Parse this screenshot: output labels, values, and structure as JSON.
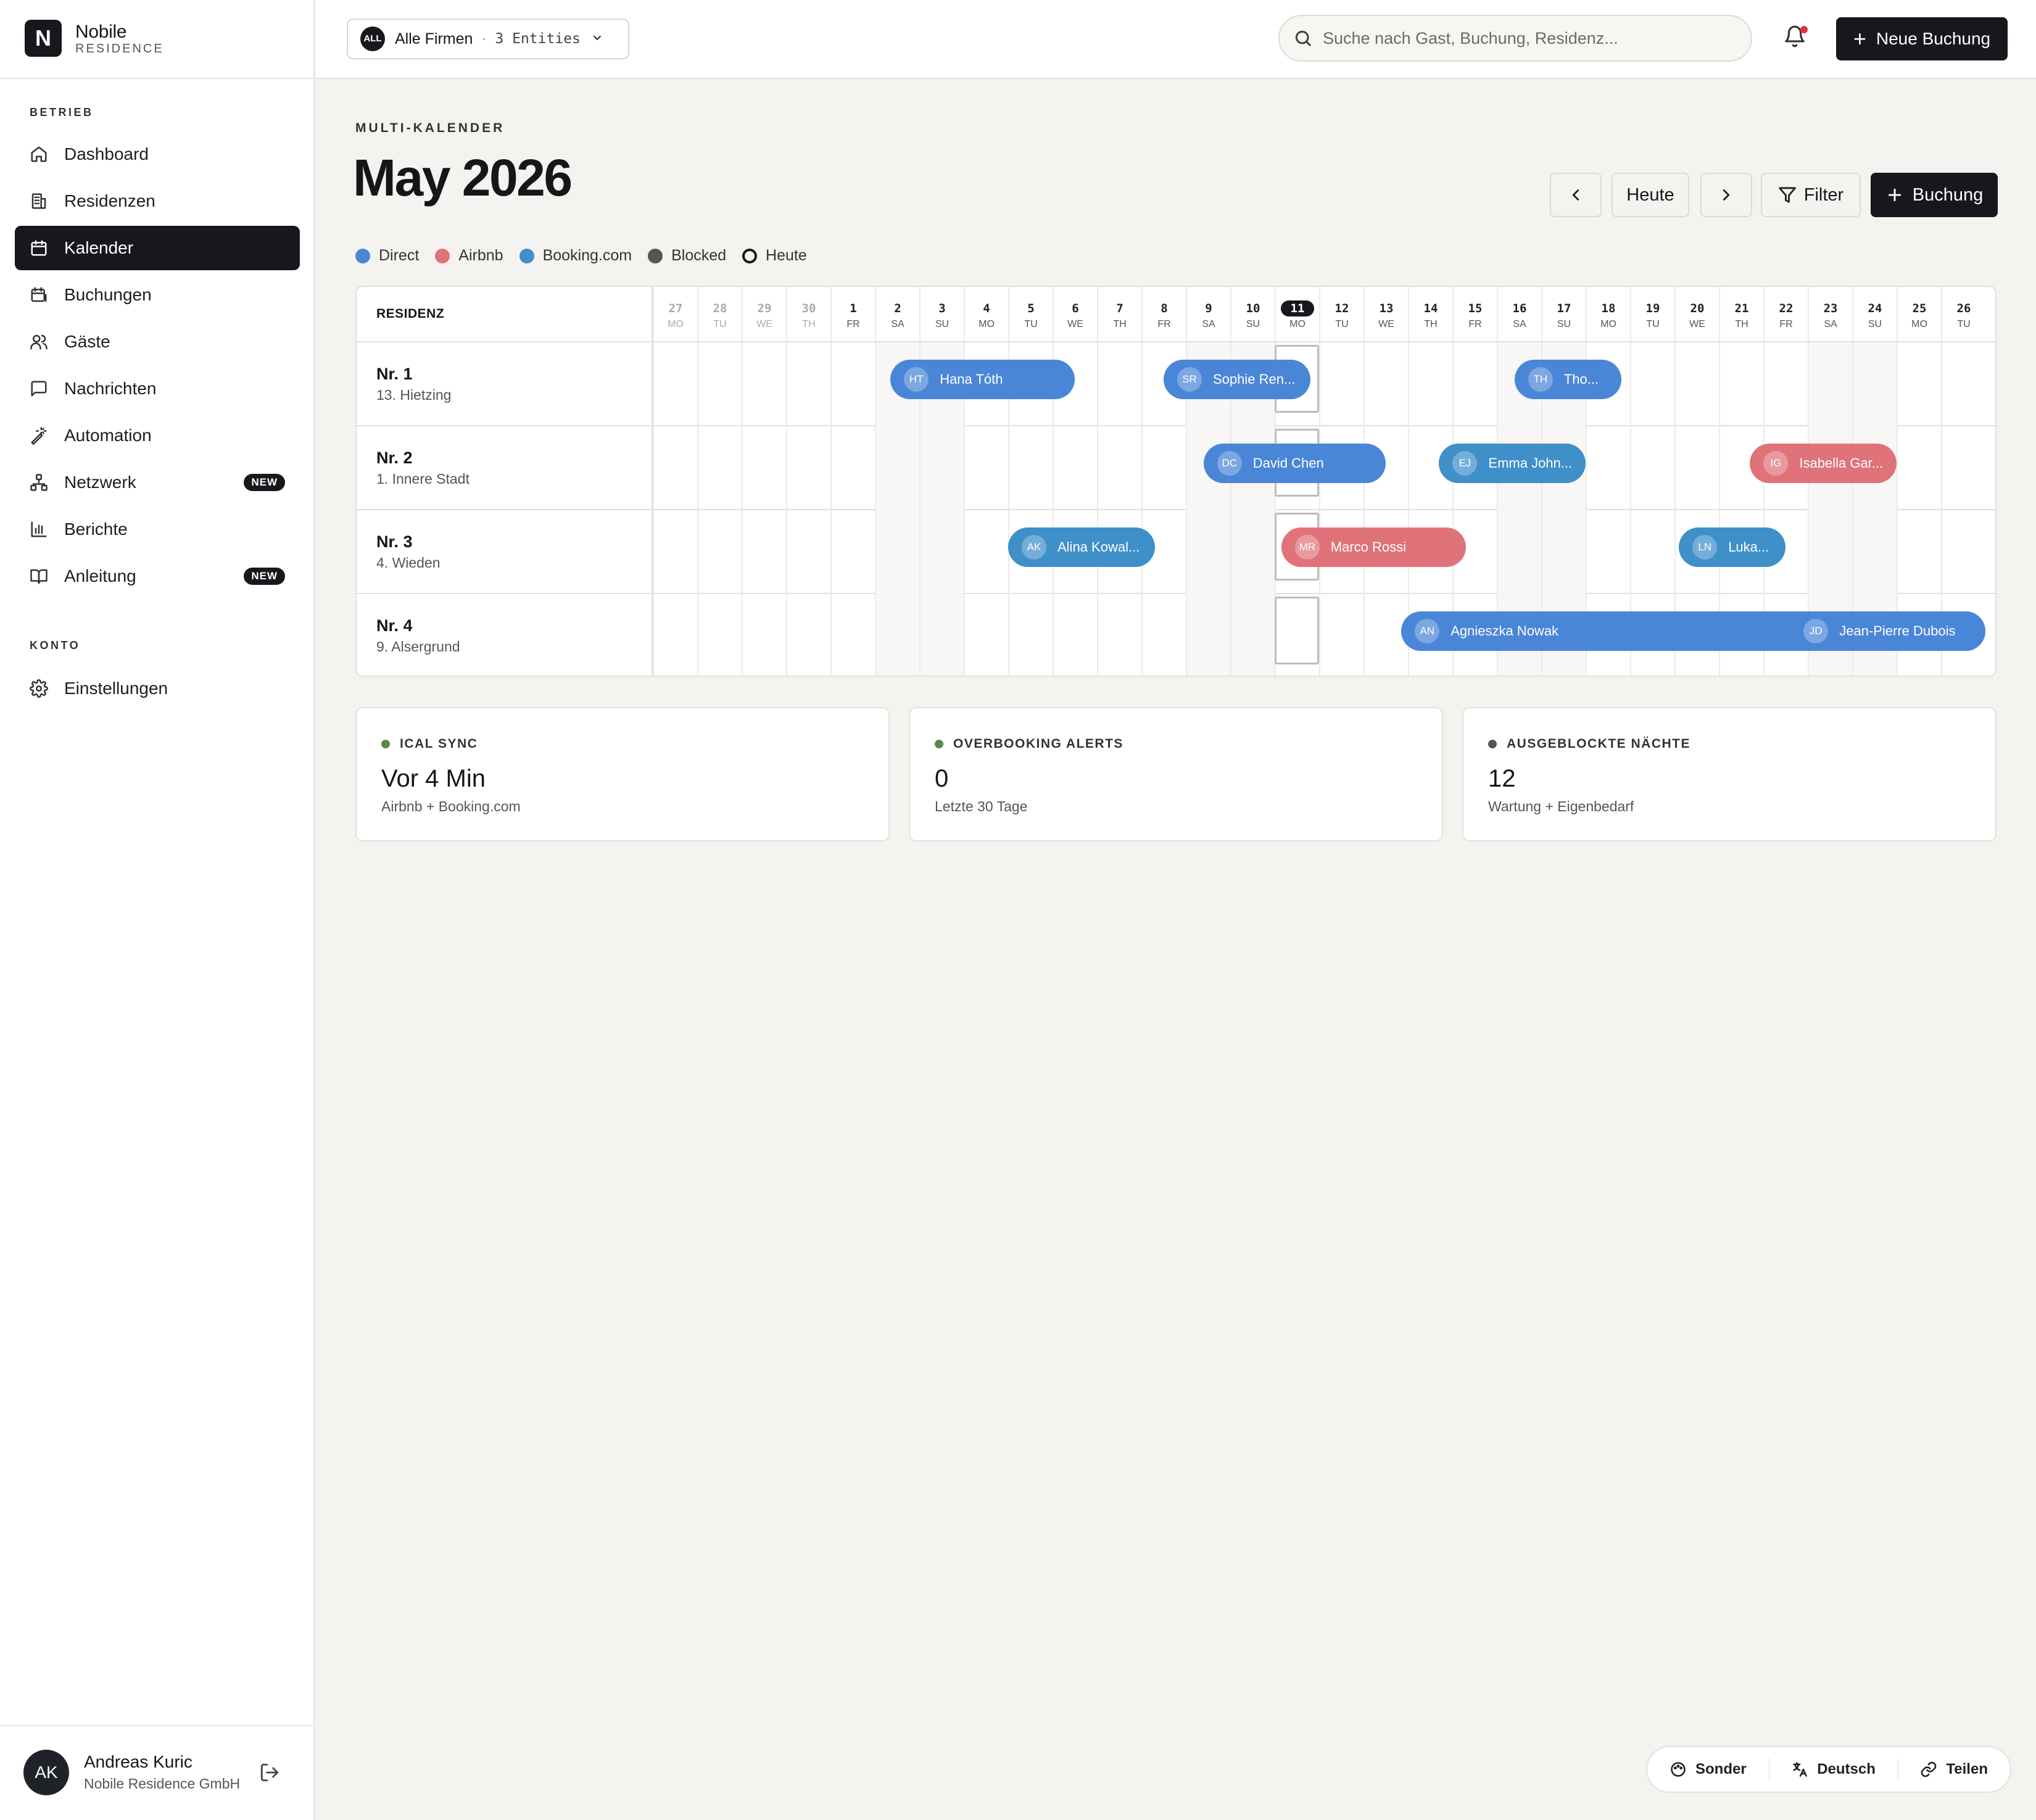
{
  "brand": {
    "name": "Nobile",
    "sub": "RESIDENCE",
    "logo_letter": "N"
  },
  "sidebar": {
    "section_ops": "BETRIEB",
    "section_account": "KONTO",
    "items": [
      {
        "label": "Dashboard",
        "icon": "home-icon"
      },
      {
        "label": "Residenzen",
        "icon": "building-icon"
      },
      {
        "label": "Kalender",
        "icon": "calendar-icon",
        "active": true
      },
      {
        "label": "Buchungen",
        "icon": "bookings-icon"
      },
      {
        "label": "Gäste",
        "icon": "users-icon"
      },
      {
        "label": "Nachrichten",
        "icon": "message-icon"
      },
      {
        "label": "Automation",
        "icon": "wand-icon"
      },
      {
        "label": "Netzwerk",
        "icon": "network-icon",
        "badge": "NEW"
      },
      {
        "label": "Berichte",
        "icon": "chart-icon"
      },
      {
        "label": "Anleitung",
        "icon": "book-icon",
        "badge": "NEW"
      }
    ],
    "account_items": [
      {
        "label": "Einstellungen",
        "icon": "gear-icon"
      }
    ],
    "user": {
      "initials": "AK",
      "name": "Andreas Kuric",
      "company": "Nobile Residence GmbH"
    }
  },
  "topbar": {
    "company_badge": "ALL",
    "company_name": "Alle Firmen",
    "separator": "·",
    "entities": "3 Entities",
    "search_placeholder": "Suche nach Gast, Buchung, Residenz...",
    "new_booking": "Neue Buchung"
  },
  "page": {
    "eyebrow": "MULTI-KALENDER",
    "title": "May 2026",
    "today_btn": "Heute",
    "filter_btn": "Filter",
    "booking_btn": "Buchung"
  },
  "legend": [
    {
      "label": "Direct",
      "color": "#4a86d8"
    },
    {
      "label": "Airbnb",
      "color": "#e0737a"
    },
    {
      "label": "Booking.com",
      "color": "#3f8fc9"
    },
    {
      "label": "Blocked",
      "color": "#555555"
    },
    {
      "label": "Heute",
      "color": "ring"
    }
  ],
  "calendar": {
    "column_header": "RESIDENZ",
    "days": [
      {
        "n": "27",
        "w": "MO",
        "prev": true
      },
      {
        "n": "28",
        "w": "TU",
        "prev": true
      },
      {
        "n": "29",
        "w": "WE",
        "prev": true
      },
      {
        "n": "30",
        "w": "TH",
        "prev": true
      },
      {
        "n": "1",
        "w": "FR"
      },
      {
        "n": "2",
        "w": "SA",
        "weekend": true
      },
      {
        "n": "3",
        "w": "SU",
        "weekend": true
      },
      {
        "n": "4",
        "w": "MO"
      },
      {
        "n": "5",
        "w": "TU"
      },
      {
        "n": "6",
        "w": "WE"
      },
      {
        "n": "7",
        "w": "TH"
      },
      {
        "n": "8",
        "w": "FR"
      },
      {
        "n": "9",
        "w": "SA",
        "weekend": true
      },
      {
        "n": "10",
        "w": "SU",
        "weekend": true
      },
      {
        "n": "11",
        "w": "MO",
        "today": true
      },
      {
        "n": "12",
        "w": "TU"
      },
      {
        "n": "13",
        "w": "WE"
      },
      {
        "n": "14",
        "w": "TH"
      },
      {
        "n": "15",
        "w": "FR"
      },
      {
        "n": "16",
        "w": "SA",
        "weekend": true
      },
      {
        "n": "17",
        "w": "SU",
        "weekend": true
      },
      {
        "n": "18",
        "w": "MO"
      },
      {
        "n": "19",
        "w": "TU"
      },
      {
        "n": "20",
        "w": "WE"
      },
      {
        "n": "21",
        "w": "TH"
      },
      {
        "n": "22",
        "w": "FR"
      },
      {
        "n": "23",
        "w": "SA",
        "weekend": true
      },
      {
        "n": "24",
        "w": "SU",
        "weekend": true
      },
      {
        "n": "25",
        "w": "MO"
      },
      {
        "n": "26",
        "w": "TU"
      }
    ],
    "residences": [
      {
        "name": "Nr. 1",
        "district": "13. Hietzing",
        "bookings": [
          {
            "initials": "HT",
            "guest": "Hana Tóth",
            "channel": "direct",
            "start": 5.35,
            "end": 9.5
          },
          {
            "initials": "SR",
            "guest": "Sophie Ren...",
            "channel": "direct",
            "start": 11.5,
            "end": 14.8
          },
          {
            "initials": "TH",
            "guest": "Tho...",
            "channel": "direct",
            "start": 19.4,
            "end": 21.8
          }
        ]
      },
      {
        "name": "Nr. 2",
        "district": "1. Innere Stadt",
        "bookings": [
          {
            "initials": "DC",
            "guest": "David Chen",
            "channel": "direct",
            "start": 12.4,
            "end": 16.5
          },
          {
            "initials": "EJ",
            "guest": "Emma John...",
            "channel": "booking",
            "start": 17.7,
            "end": 21.0
          },
          {
            "initials": "IG",
            "guest": "Isabella Gar...",
            "channel": "airbnb",
            "start": 24.7,
            "end": 28.0
          }
        ]
      },
      {
        "name": "Nr. 3",
        "district": "4. Wieden",
        "bookings": [
          {
            "initials": "AK",
            "guest": "Alina Kowal...",
            "channel": "booking",
            "start": 8.0,
            "end": 11.3
          },
          {
            "initials": "MR",
            "guest": "Marco Rossi",
            "channel": "airbnb",
            "start": 14.15,
            "end": 18.3
          },
          {
            "initials": "LN",
            "guest": "Luka...",
            "channel": "booking",
            "start": 23.1,
            "end": 25.5
          }
        ]
      },
      {
        "name": "Nr. 4",
        "district": "9. Alsergrund",
        "bookings": [
          {
            "initials": "AN",
            "guest": "Agnieszka Nowak",
            "channel": "direct",
            "start": 16.85,
            "end": 30.0
          },
          {
            "initials": "JD",
            "guest": "Jean-Pierre Dubois",
            "channel": "direct",
            "start": 25.6,
            "end": 30.0
          }
        ]
      }
    ]
  },
  "stats": [
    {
      "label": "ICAL SYNC",
      "value": "Vor 4 Min",
      "sub": "Airbnb + Booking.com",
      "dot": "#5a8a4a"
    },
    {
      "label": "OVERBOOKING ALERTS",
      "value": "0",
      "sub": "Letzte 30 Tage",
      "dot": "#5a8a4a"
    },
    {
      "label": "AUSGEBLOCKTE NÄCHTE",
      "value": "12",
      "sub": "Wartung + Eigenbedarf",
      "dot": "#555555"
    }
  ],
  "floatbar": {
    "sonder": "Sonder",
    "language": "Deutsch",
    "share": "Teilen"
  }
}
